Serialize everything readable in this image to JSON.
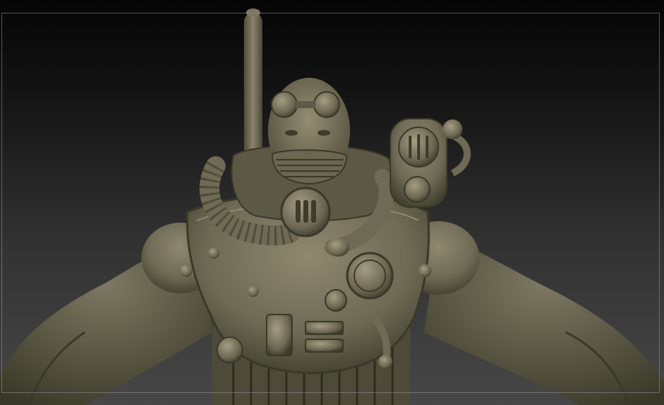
{
  "viewport": {
    "background_top": "#050505",
    "background_bottom": "#474747",
    "frame_color": "#969696"
  },
  "model": {
    "material_base": "#6e6a55",
    "material_light": "#9a947a",
    "material_dark": "#3a3828",
    "icon": "diver-sculpt-icon"
  }
}
